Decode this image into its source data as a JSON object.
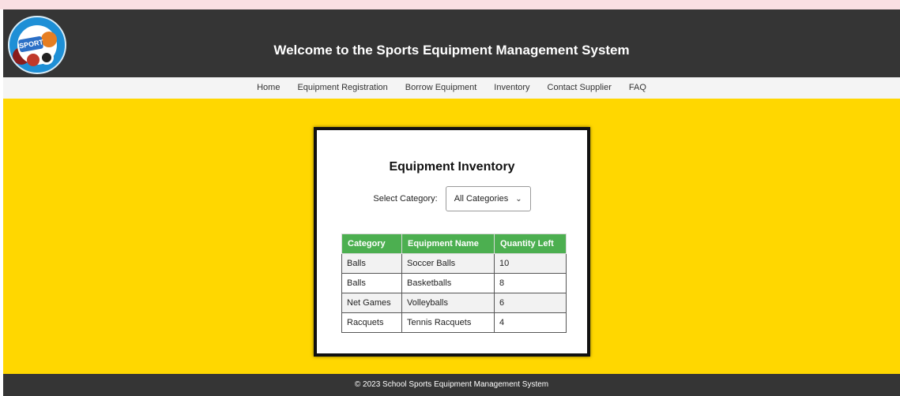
{
  "header": {
    "logo_text": "SPORT",
    "title": "Welcome to the Sports Equipment Management System"
  },
  "nav": {
    "items": [
      {
        "label": "Home"
      },
      {
        "label": "Equipment Registration"
      },
      {
        "label": "Borrow Equipment"
      },
      {
        "label": "Inventory"
      },
      {
        "label": "Contact Supplier"
      },
      {
        "label": "FAQ"
      }
    ]
  },
  "inventory": {
    "title": "Equipment Inventory",
    "filter_label": "Select Category:",
    "selected_category": "All Categories",
    "columns": [
      "Category",
      "Equipment Name",
      "Quantity Left"
    ],
    "rows": [
      {
        "category": "Balls",
        "name": "Soccer Balls",
        "quantity": "10"
      },
      {
        "category": "Balls",
        "name": "Basketballs",
        "quantity": "8"
      },
      {
        "category": "Net Games",
        "name": "Volleyballs",
        "quantity": "6"
      },
      {
        "category": "Racquets",
        "name": "Tennis Racquets",
        "quantity": "4"
      }
    ]
  },
  "footer": {
    "text": "© 2023 School Sports Equipment Management System"
  },
  "colors": {
    "header_bg": "#353535",
    "main_bg": "#ffd700",
    "table_header": "#4caf50"
  }
}
